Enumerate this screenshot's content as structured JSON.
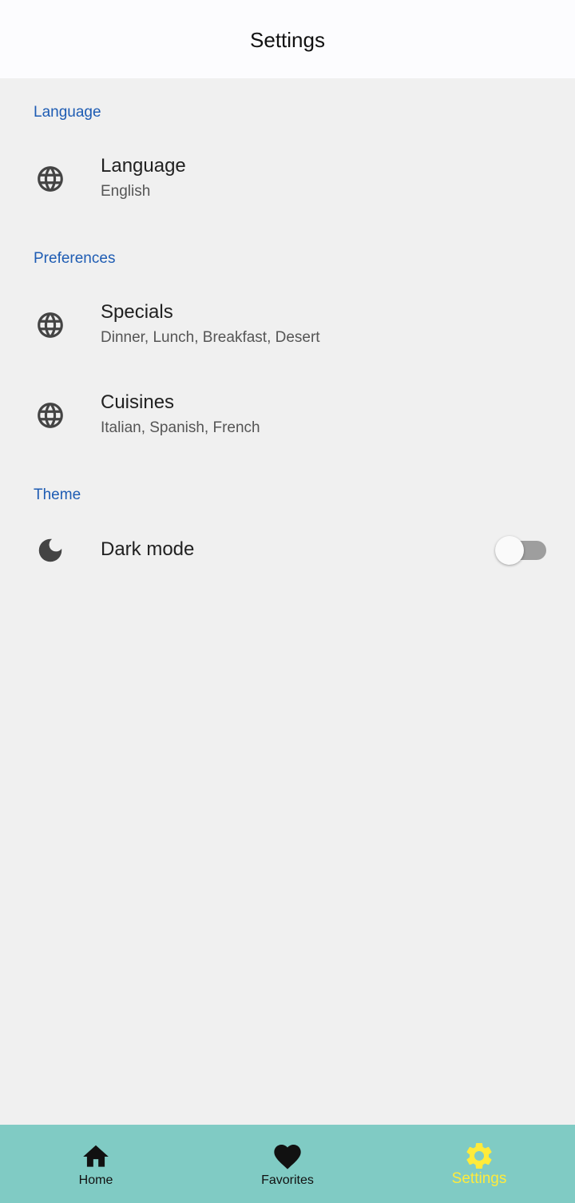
{
  "app_bar": {
    "title": "Settings"
  },
  "sections": {
    "language": {
      "header": "Language",
      "tile": {
        "title": "Language",
        "subtitle": "English",
        "icon": "globe-icon"
      }
    },
    "preferences": {
      "header": "Preferences",
      "specials": {
        "title": "Specials",
        "subtitle": "Dinner, Lunch, Breakfast, Desert",
        "icon": "globe-icon"
      },
      "cuisines": {
        "title": "Cuisines",
        "subtitle": "Italian, Spanish, French",
        "icon": "globe-icon"
      }
    },
    "theme": {
      "header": "Theme",
      "dark_mode": {
        "title": "Dark mode",
        "icon": "moon-icon",
        "enabled": false
      }
    }
  },
  "bottom_nav": {
    "items": [
      {
        "label": "Home",
        "icon": "home-icon",
        "active": false
      },
      {
        "label": "Favorites",
        "icon": "heart-icon",
        "active": false
      },
      {
        "label": "Settings",
        "icon": "gear-icon",
        "active": true
      }
    ]
  },
  "colors": {
    "section_header": "#1e5cb3",
    "nav_background": "#80cbc4",
    "nav_active": "#ffeb3b",
    "background": "#f0f0f0"
  }
}
